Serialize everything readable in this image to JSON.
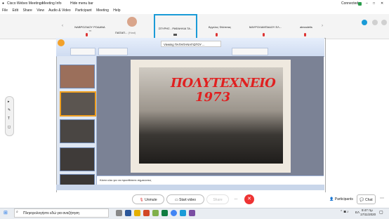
{
  "window": {
    "app_title": "Cisco Webex Meetings",
    "meeting_info": "Meeting Info",
    "hide_menu_bar": "Hide menu bar",
    "status": "Connected"
  },
  "menu": [
    "File",
    "Edit",
    "Share",
    "View",
    "Audio & Video",
    "Participant",
    "Meeting",
    "Help"
  ],
  "participants": [
    {
      "name": "ΝΑΒΡΟΖΙΔΟΥ ΡΟΔΑΝΑ",
      "sub": "·m"
    },
    {
      "name": "ΠΑΠΑΠ...",
      "sub": "(Host)",
      "highlight": false
    },
    {
      "name": "ΣΠΥΡΗΣ - ΡΑΦΑΗΛΙΑ ΤΑ...",
      "highlight": true
    },
    {
      "name": "Άγγελος Φιλίππας"
    },
    {
      "name": "ΜΑΥΡΟΛΑΜΠΑΔΟΥ ΕΛ..."
    },
    {
      "name": "alexadelis"
    }
  ],
  "share": {
    "viewing_label": "Viewing ΠΑΠΑΠΑΝΑΓΙΩΤΟΥ ..."
  },
  "slide": {
    "title_line1": "ΠΟΛΥΤΕΧΝΕΙΟ",
    "title_line2": "1973"
  },
  "notes_placeholder": "Κάντε κλικ για να προσθέσετε σημειώσεις",
  "controls": {
    "unmute": "Unmute",
    "start_video": "Start video",
    "share": "Share",
    "more": "···",
    "participants": "Participants",
    "chat": "Chat"
  },
  "taskbar": {
    "search_placeholder": "Πληκτρολογήστε εδώ για αναζήτηση",
    "language": "ΕΛ",
    "time": "9:47 πμ",
    "date": "17/11/2020"
  },
  "colors": {
    "accent": "#1a9bd7",
    "leave": "#e33333",
    "slide_title": "#e02020"
  }
}
